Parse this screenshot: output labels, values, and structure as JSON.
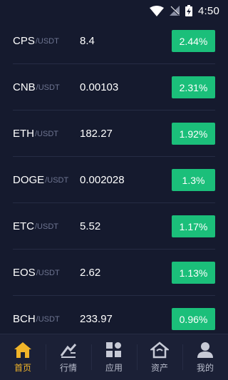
{
  "status_bar": {
    "time": "4:50"
  },
  "rows": [
    {
      "base": "CPS",
      "quote": "/USDT",
      "price": "8.4",
      "change": "2.44%"
    },
    {
      "base": "CNB",
      "quote": "/USDT",
      "price": "0.00103",
      "change": "2.31%"
    },
    {
      "base": "ETH",
      "quote": "/USDT",
      "price": "182.27",
      "change": "1.92%"
    },
    {
      "base": "DOGE",
      "quote": "/USDT",
      "price": "0.002028",
      "change": "1.3%"
    },
    {
      "base": "ETC",
      "quote": "/USDT",
      "price": "5.52",
      "change": "1.17%"
    },
    {
      "base": "EOS",
      "quote": "/USDT",
      "price": "2.62",
      "change": "1.13%"
    },
    {
      "base": "BCH",
      "quote": "/USDT",
      "price": "233.97",
      "change": "0.96%"
    }
  ],
  "tabs": [
    {
      "label": "首页",
      "icon": "home-icon",
      "active": true
    },
    {
      "label": "行情",
      "icon": "market-chart-icon",
      "active": false
    },
    {
      "label": "应用",
      "icon": "apps-grid-icon",
      "active": false
    },
    {
      "label": "资产",
      "icon": "assets-house-icon",
      "active": false
    },
    {
      "label": "我的",
      "icon": "profile-icon",
      "active": false
    }
  ],
  "colors": {
    "background": "#151a2e",
    "positive": "#1bbf7a",
    "active_tab": "#f0b429",
    "muted_text": "#6e7591"
  }
}
